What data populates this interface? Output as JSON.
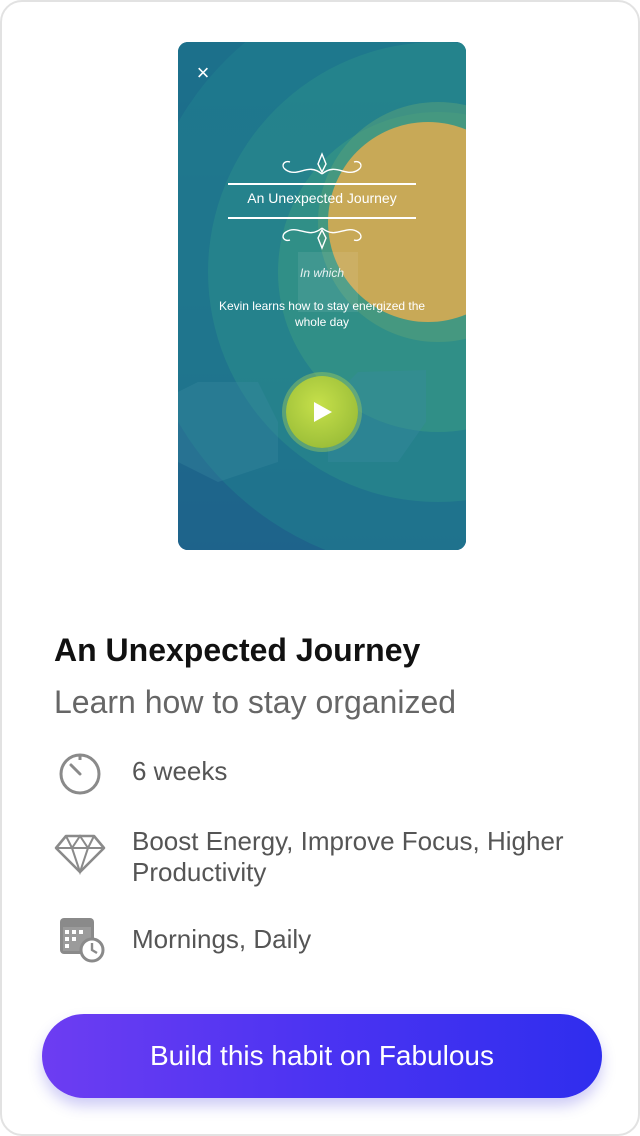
{
  "preview": {
    "close_symbol": "×",
    "title": "An Unexpected Journey",
    "in_which": "In which",
    "description": "Kevin learns how to stay energized the whole day",
    "play_icon": "play-icon",
    "colors": {
      "teal": "#1d6f86",
      "sun": "#c8a957",
      "play": "#a8c83c"
    }
  },
  "journey": {
    "title": "An Unexpected Journey",
    "subtitle": "Learn how to stay organized",
    "details": [
      {
        "icon": "timer-icon",
        "text": "6 weeks"
      },
      {
        "icon": "diamond-icon",
        "text": "Boost Energy, Improve Focus, Higher Productivity"
      },
      {
        "icon": "calendar-clock-icon",
        "text": "Mornings, Daily"
      }
    ]
  },
  "cta": {
    "label": "Build this habit on Fabulous",
    "colors": [
      "#6d3df2",
      "#2f2eee"
    ]
  }
}
